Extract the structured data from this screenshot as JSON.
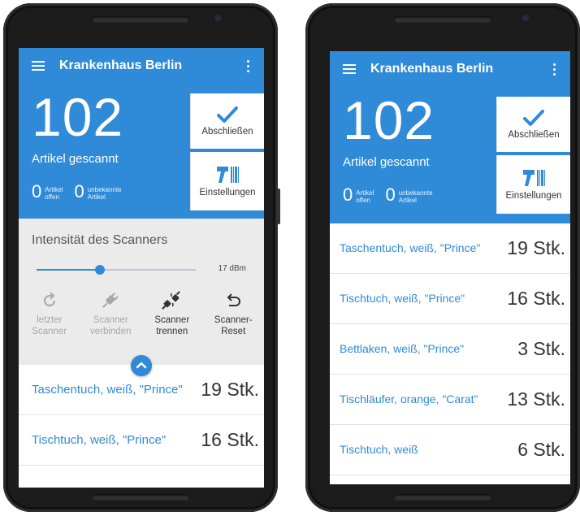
{
  "app": {
    "title": "Krankenhaus Berlin"
  },
  "summary": {
    "count": "102",
    "count_label": "Artikel gescannt",
    "open_count": "0",
    "open_label_1": "Artikel",
    "open_label_2": "offen",
    "unknown_count": "0",
    "unknown_label_1": "unbekannte",
    "unknown_label_2": "Artikel"
  },
  "buttons": {
    "finish": "Abschließen",
    "settings": "Einstellungen"
  },
  "scanner": {
    "title": "Intensität des Scanners",
    "value_text": "17 dBm",
    "level": 0.4,
    "actions": [
      {
        "line1": "letzter",
        "line2": "Scanner",
        "enabled": false,
        "icon": "refresh-icon"
      },
      {
        "line1": "Scanner",
        "line2": "verbinden",
        "enabled": false,
        "icon": "plug-connect-icon"
      },
      {
        "line1": "Scanner",
        "line2": "trennen",
        "enabled": true,
        "icon": "plug-disconnect-icon"
      },
      {
        "line1": "Scanner-",
        "line2": "Reset",
        "enabled": true,
        "icon": "undo-icon"
      }
    ]
  },
  "left_list": [
    {
      "name": "Taschentuch, weiß, \"Prince\"",
      "qty": "19 Stk."
    },
    {
      "name": "Tischtuch, weiß, \"Prince\"",
      "qty": "16 Stk."
    }
  ],
  "right_list": [
    {
      "name": "Taschentuch, weiß, \"Prince\"",
      "qty": "19 Stk."
    },
    {
      "name": "Tischtuch, weiß, \"Prince\"",
      "qty": "16 Stk."
    },
    {
      "name": "Bettlaken, weiß, \"Prince\"",
      "qty": "3 Stk."
    },
    {
      "name": "Tischläufer, orange, \"Carat\"",
      "qty": "13 Stk."
    },
    {
      "name": "Tischtuch, weiß",
      "qty": "6 Stk."
    }
  ],
  "colors": {
    "accent": "#2f8ad8",
    "panel": "#ebebeb"
  }
}
